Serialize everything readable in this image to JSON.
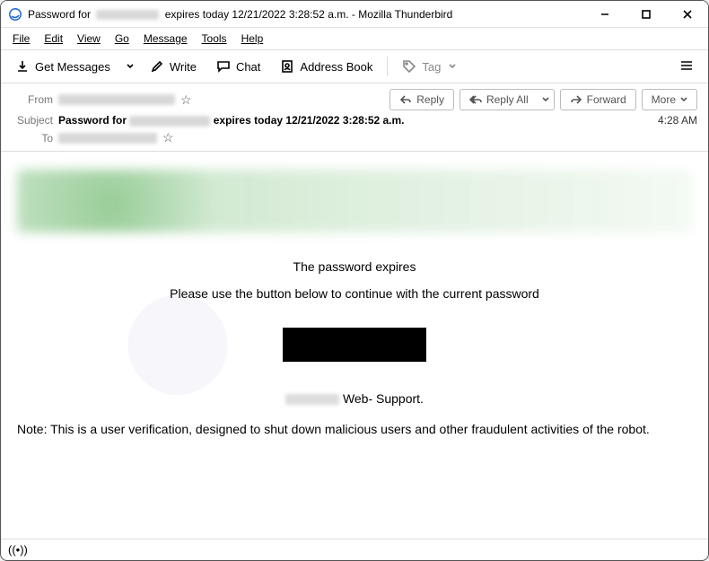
{
  "titlebar": {
    "prefix": "Password for",
    "suffix": "expires today 12/21/2022 3:28:52 a.m. - Mozilla Thunderbird"
  },
  "menubar": {
    "file": "File",
    "edit": "Edit",
    "view": "View",
    "go": "Go",
    "message": "Message",
    "tools": "Tools",
    "help": "Help"
  },
  "toolbar": {
    "get_messages": "Get Messages",
    "write": "Write",
    "chat": "Chat",
    "address_book": "Address Book",
    "tag": "Tag"
  },
  "header": {
    "from_label": "From",
    "subject_label": "Subject",
    "to_label": "To",
    "subject_prefix": "Password for",
    "subject_suffix": "expires today 12/21/2022 3:28:52 a.m.",
    "time": "4:28 AM"
  },
  "actions": {
    "reply": "Reply",
    "reply_all": "Reply All",
    "forward": "Forward",
    "more": "More"
  },
  "body": {
    "line1": "The password expires",
    "line2": "Please use the button below to continue with the current password",
    "support_suffix": "Web- Support.",
    "note": "Note: This is a user verification, designed to shut down malicious users and other fraudulent activities of the robot."
  },
  "status": {
    "icon_name": "connection-status-icon"
  }
}
